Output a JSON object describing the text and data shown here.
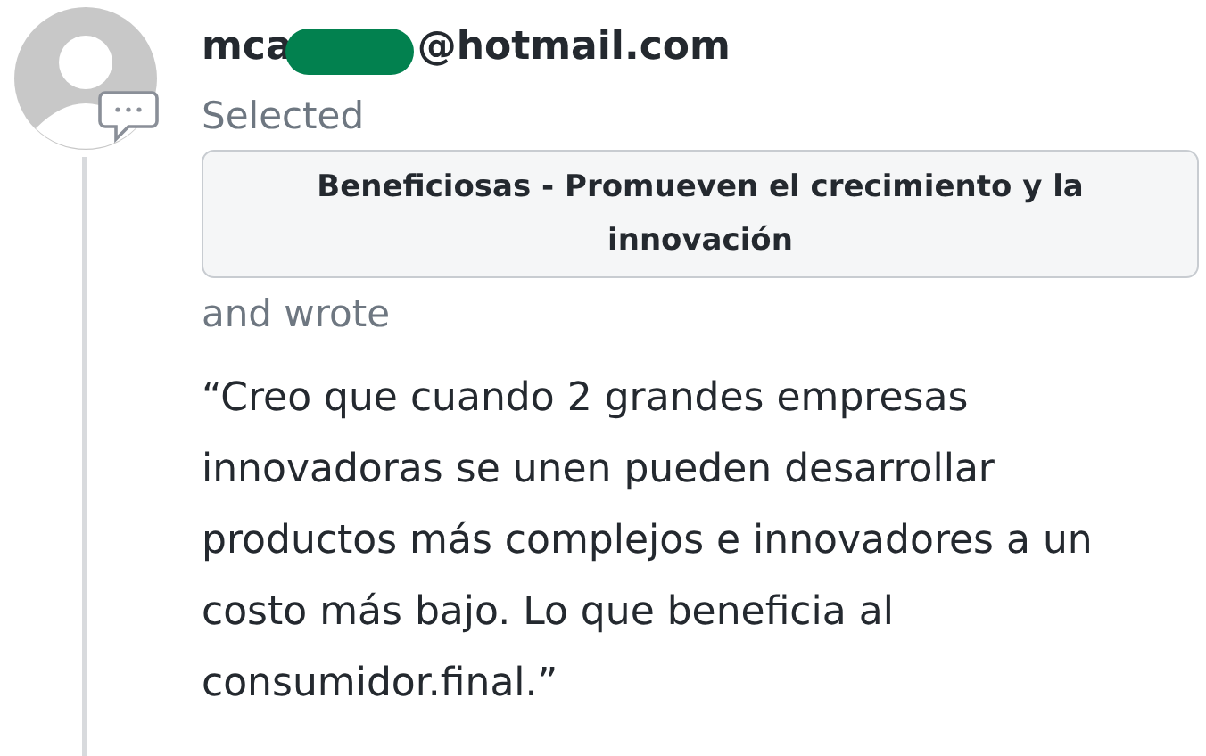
{
  "author": {
    "email_start": "mca",
    "email_end": "@hotmail.com"
  },
  "selected_label": "Selected",
  "choice": "Beneficiosas - Promueven el crecimiento y la innovación",
  "wrote_label": "and wrote",
  "quote": "“Creo que cuando 2 grandes empresas innovadoras se unen pueden desarrollar productos más complejos e innovadores a un costo más bajo. Lo que beneficia al consumidor.final.”"
}
